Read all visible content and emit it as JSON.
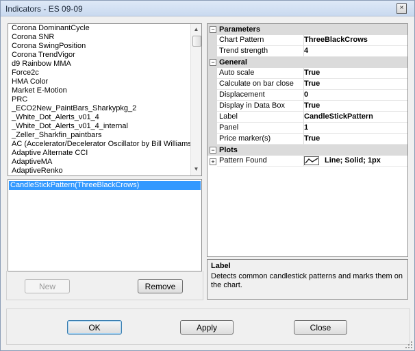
{
  "window": {
    "title": "Indicators - ES 09-09",
    "close_label": "×"
  },
  "indicator_list": {
    "items": [
      "Corona DominantCycle",
      "Corona SNR",
      "Corona SwingPosition",
      "Corona TrendVigor",
      "d9 Rainbow MMA",
      "Force2c",
      "HMA Color",
      "Market E-Motion",
      "PRC",
      "_ECO2New_PaintBars_Sharkypkg_2",
      "_White_Dot_Alerts_v01_4",
      "_White_Dot_Alerts_v01_4_internal",
      "_Zeller_Sharkfin_paintbars",
      "AC (Accelerator/Decelerator Oscillator by Bill Williams)",
      "Adaptive Alternate CCI",
      "AdaptiveMA",
      "AdaptiveRenko"
    ],
    "scroll_up": "▲",
    "scroll_down": "▼"
  },
  "applied": {
    "items": [
      "CandleStickPattern(ThreeBlackCrows)"
    ]
  },
  "buttons": {
    "new": "New",
    "remove": "Remove",
    "ok": "OK",
    "apply": "Apply",
    "close": "Close"
  },
  "properties": {
    "categories": {
      "parameters": "Parameters",
      "general": "General",
      "plots": "Plots"
    },
    "toggle_collapsed": "+",
    "toggle_expanded": "−",
    "parameters": [
      {
        "name": "Chart Pattern",
        "value": "ThreeBlackCrows"
      },
      {
        "name": "Trend strength",
        "value": "4"
      }
    ],
    "general": [
      {
        "name": "Auto scale",
        "value": "True"
      },
      {
        "name": "Calculate on bar close",
        "value": "True"
      },
      {
        "name": "Displacement",
        "value": "0"
      },
      {
        "name": "Display in Data Box",
        "value": "True"
      },
      {
        "name": "Label",
        "value": "CandleStickPattern"
      },
      {
        "name": "Panel",
        "value": "1"
      },
      {
        "name": "Price marker(s)",
        "value": "True"
      }
    ],
    "plots": [
      {
        "name": "Pattern Found",
        "value": "Line; Solid; 1px"
      }
    ]
  },
  "description": {
    "title": "Label",
    "text": "Detects common candlestick patterns and marks them on the chart."
  }
}
